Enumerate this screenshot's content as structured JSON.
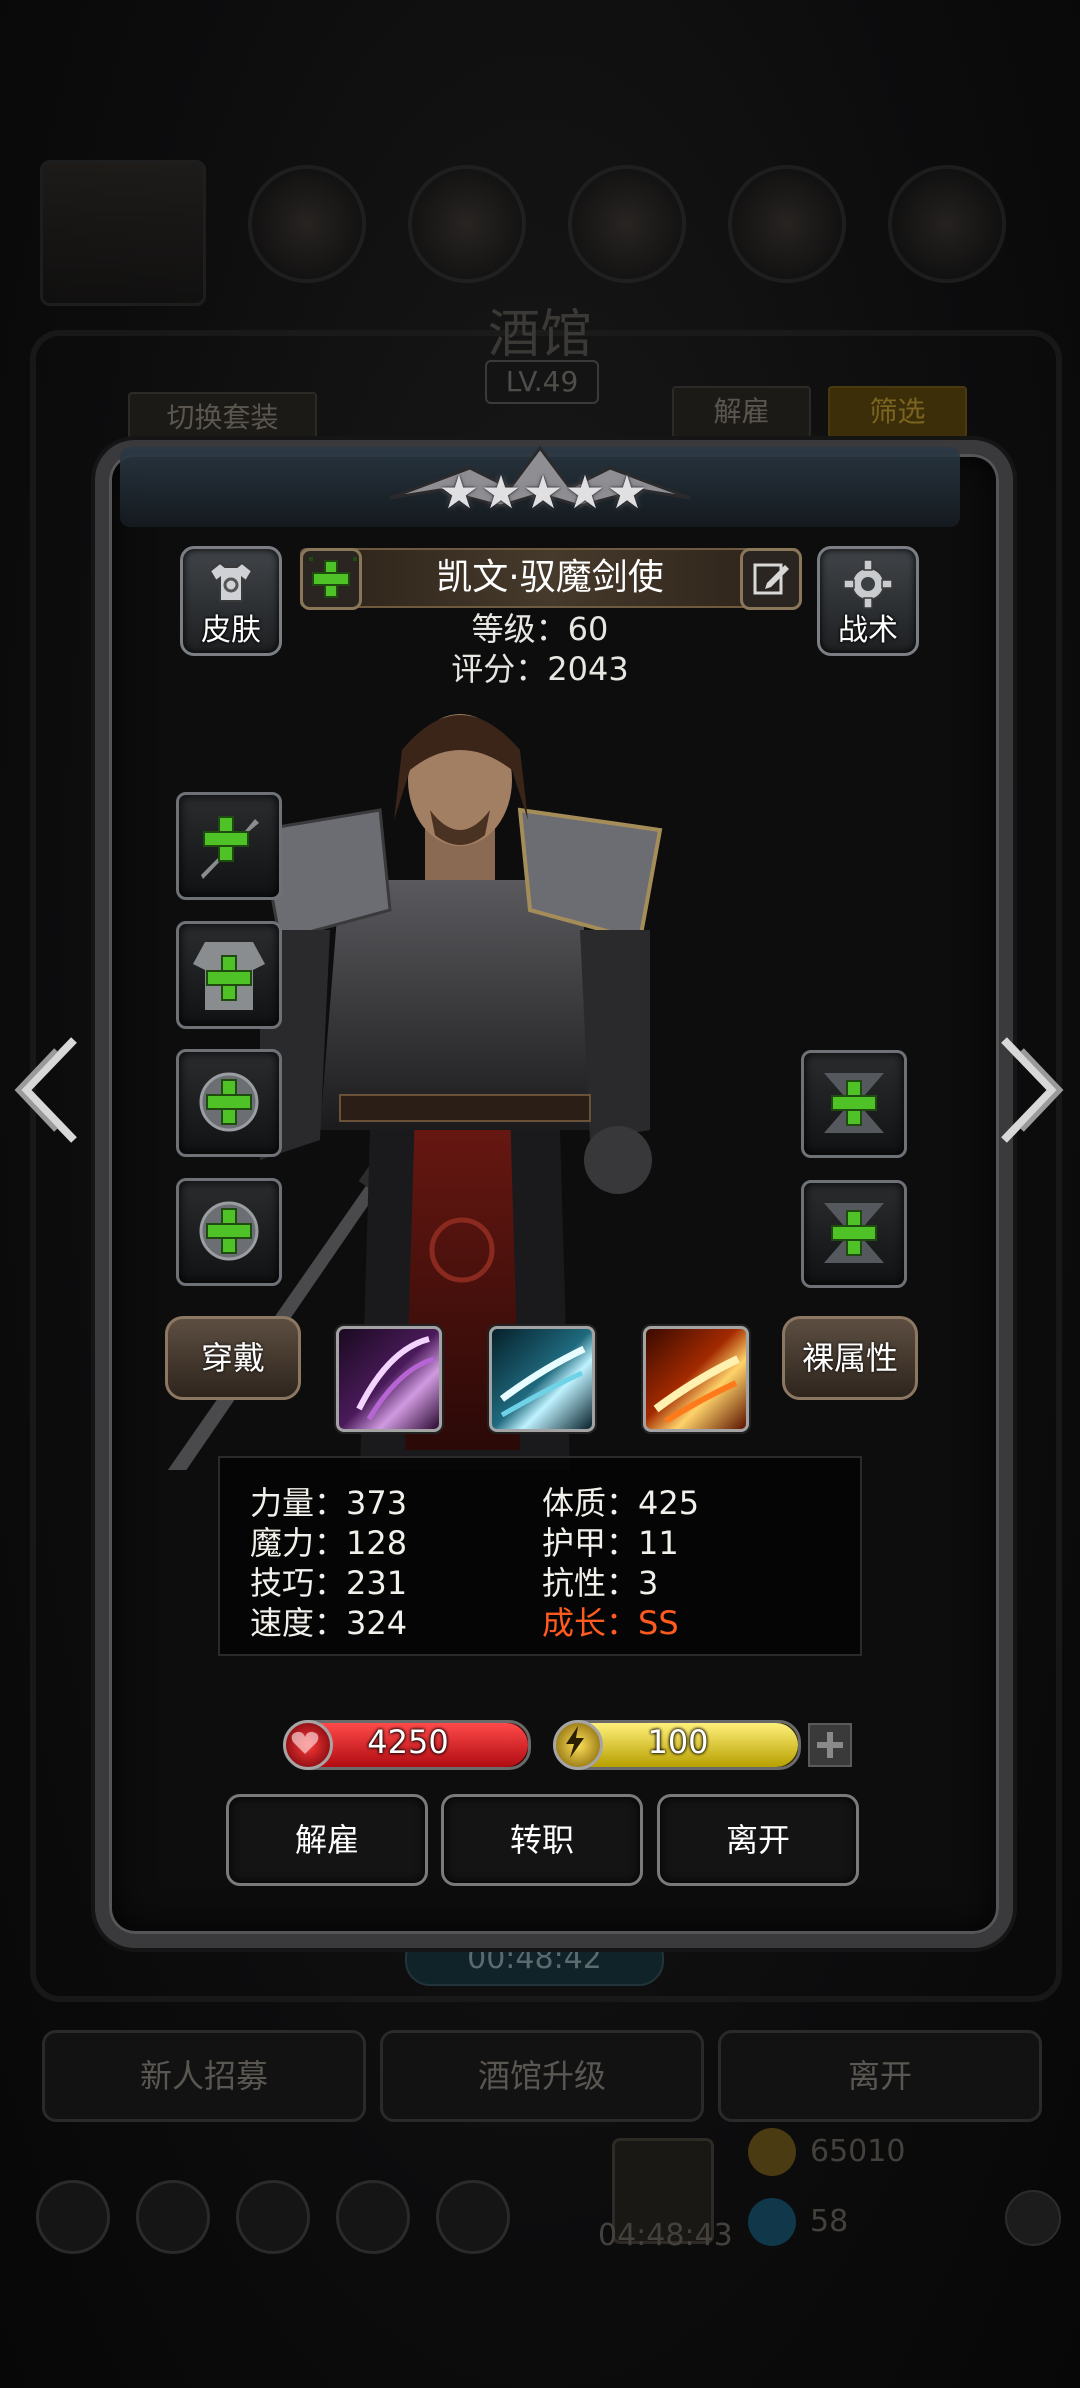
{
  "background": {
    "title": "酒馆",
    "level": "LV.49",
    "switch_outfit": "切换套装",
    "dismiss_tab": "解雇",
    "filter_tab": "筛选",
    "timer": "00:48:42",
    "recruit": "新人招募",
    "upgrade": "酒馆升级",
    "leave": "离开",
    "gold": "65010",
    "gems": "58",
    "gift_timer": "04:48:43"
  },
  "hero": {
    "stars": [
      "★",
      "★",
      "★",
      "★",
      "★"
    ],
    "name": "凯文·驭魔剑使",
    "level_line": "等级：60",
    "score_line": "评分：2043",
    "skin_label": "皮肤",
    "tactics_label": "战术"
  },
  "equipment": {
    "wear_label": "穿戴",
    "bare_stats_label": "裸属性"
  },
  "stats": {
    "strength": "力量：373",
    "magic": "魔力：128",
    "skill": "技巧：231",
    "speed": "速度：324",
    "constitution": "体质：425",
    "armor": "护甲：11",
    "resistance": "抗性：3",
    "growth": "成长：SS"
  },
  "bars": {
    "hp": "4250",
    "energy": "100",
    "hp_fill": 1.0,
    "energy_fill": 1.0
  },
  "actions": {
    "dismiss": "解雇",
    "job_change": "转职",
    "leave": "离开"
  },
  "colors": {
    "growth": "#ff5a1f",
    "hp": "#d2141c",
    "energy": "#e8d21a",
    "plus": "#4fc228"
  }
}
